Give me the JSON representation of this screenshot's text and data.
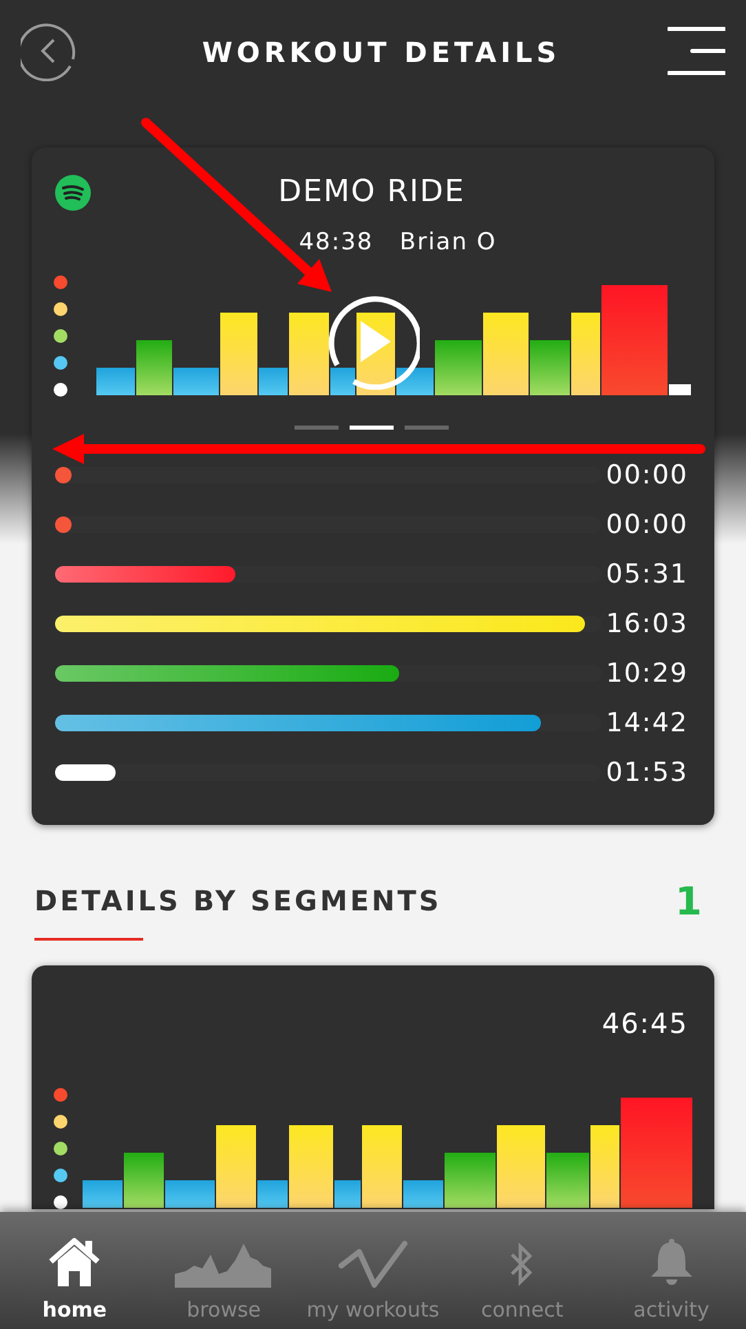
{
  "header": {
    "title": "WORKOUT DETAILS"
  },
  "ride": {
    "title": "DEMO RIDE",
    "duration": "48:38",
    "instructor": "Brian O",
    "pages": [
      {
        "selected": false
      },
      {
        "selected": true
      },
      {
        "selected": false
      }
    ],
    "zones": [
      {
        "color": "#f5553a",
        "level": 0,
        "time": "00:00"
      },
      {
        "color": "#f5553a",
        "level": 0,
        "time": "00:00"
      },
      {
        "color": "#ff1a2a",
        "level": 0.33,
        "time": "05:31"
      },
      {
        "color": "#fbe81c",
        "level": 0.97,
        "time": "16:03"
      },
      {
        "color": "#1aab12",
        "level": 0.63,
        "time": "10:29"
      },
      {
        "color": "#129ed6",
        "level": 0.89,
        "time": "14:42"
      },
      {
        "color": "#ffffff",
        "level": 0.11,
        "time": "01:53"
      }
    ]
  },
  "segments": {
    "title": "DETAILS BY SEGMENTS",
    "count": "1",
    "cards": [
      {
        "duration": "46:45"
      }
    ]
  },
  "tab_bar": [
    {
      "label": "home",
      "selected": true
    },
    {
      "label": "browse",
      "selected": false
    },
    {
      "label": "my workouts",
      "selected": false
    },
    {
      "label": "connect",
      "selected": false
    },
    {
      "label": "activity",
      "selected": false
    }
  ]
}
